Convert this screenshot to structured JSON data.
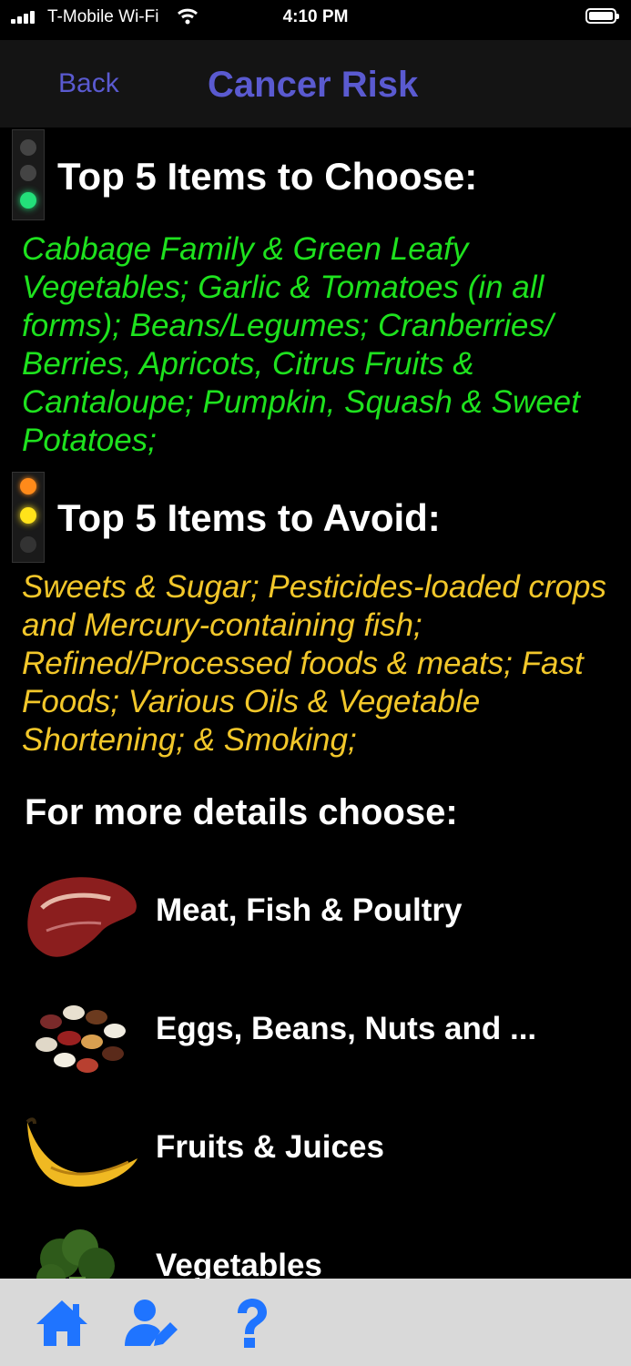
{
  "status": {
    "carrier": "T-Mobile Wi-Fi",
    "time": "4:10 PM"
  },
  "nav": {
    "back_label": "Back",
    "title": "Cancer Risk"
  },
  "choose": {
    "title": "Top 5 Items to Choose:",
    "text": "Cabbage Family & Green Leafy Vegetables; Garlic & Tomatoes (in all forms); Beans/Legumes; Cranberries/ Berries, Apricots, Citrus Fruits & Cantaloupe; Pumpkin, Squash & Sweet Potatoes;",
    "color": "#1ee21e"
  },
  "avoid": {
    "title": "Top 5 Items to Avoid:",
    "text": "Sweets & Sugar; Pesticides-loaded crops and Mercury-containing fish; Refined/Processed foods & meats; Fast Foods; Various Oils & Vegetable Shortening; & Smoking;",
    "color": "#f2c72a"
  },
  "more_title": "For more details choose:",
  "categories": [
    {
      "label": "Meat, Fish & Poultry",
      "icon": "steak-icon"
    },
    {
      "label": "Eggs, Beans, Nuts and ...",
      "icon": "beans-icon"
    },
    {
      "label": "Fruits & Juices",
      "icon": "banana-icon"
    },
    {
      "label": "Vegetables",
      "icon": "broccoli-icon"
    }
  ],
  "toolbar": {
    "icons": [
      "home-icon",
      "user-edit-icon",
      "help-icon"
    ],
    "accent": "#1f74ff"
  }
}
